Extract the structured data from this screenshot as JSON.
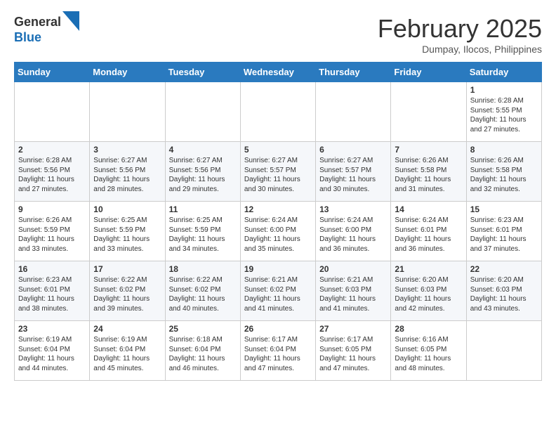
{
  "logo": {
    "general": "General",
    "blue": "Blue"
  },
  "header": {
    "month": "February 2025",
    "location": "Dumpay, Ilocos, Philippines"
  },
  "weekdays": [
    "Sunday",
    "Monday",
    "Tuesday",
    "Wednesday",
    "Thursday",
    "Friday",
    "Saturday"
  ],
  "weeks": [
    [
      null,
      null,
      null,
      null,
      null,
      null,
      {
        "day": "1",
        "sunrise": "6:28 AM",
        "sunset": "5:55 PM",
        "daylight": "11 hours and 27 minutes."
      }
    ],
    [
      {
        "day": "2",
        "sunrise": "6:28 AM",
        "sunset": "5:56 PM",
        "daylight": "11 hours and 27 minutes."
      },
      {
        "day": "3",
        "sunrise": "6:27 AM",
        "sunset": "5:56 PM",
        "daylight": "11 hours and 28 minutes."
      },
      {
        "day": "4",
        "sunrise": "6:27 AM",
        "sunset": "5:56 PM",
        "daylight": "11 hours and 29 minutes."
      },
      {
        "day": "5",
        "sunrise": "6:27 AM",
        "sunset": "5:57 PM",
        "daylight": "11 hours and 30 minutes."
      },
      {
        "day": "6",
        "sunrise": "6:27 AM",
        "sunset": "5:57 PM",
        "daylight": "11 hours and 30 minutes."
      },
      {
        "day": "7",
        "sunrise": "6:26 AM",
        "sunset": "5:58 PM",
        "daylight": "11 hours and 31 minutes."
      },
      {
        "day": "8",
        "sunrise": "6:26 AM",
        "sunset": "5:58 PM",
        "daylight": "11 hours and 32 minutes."
      }
    ],
    [
      {
        "day": "9",
        "sunrise": "6:26 AM",
        "sunset": "5:59 PM",
        "daylight": "11 hours and 33 minutes."
      },
      {
        "day": "10",
        "sunrise": "6:25 AM",
        "sunset": "5:59 PM",
        "daylight": "11 hours and 33 minutes."
      },
      {
        "day": "11",
        "sunrise": "6:25 AM",
        "sunset": "5:59 PM",
        "daylight": "11 hours and 34 minutes."
      },
      {
        "day": "12",
        "sunrise": "6:24 AM",
        "sunset": "6:00 PM",
        "daylight": "11 hours and 35 minutes."
      },
      {
        "day": "13",
        "sunrise": "6:24 AM",
        "sunset": "6:00 PM",
        "daylight": "11 hours and 36 minutes."
      },
      {
        "day": "14",
        "sunrise": "6:24 AM",
        "sunset": "6:01 PM",
        "daylight": "11 hours and 36 minutes."
      },
      {
        "day": "15",
        "sunrise": "6:23 AM",
        "sunset": "6:01 PM",
        "daylight": "11 hours and 37 minutes."
      }
    ],
    [
      {
        "day": "16",
        "sunrise": "6:23 AM",
        "sunset": "6:01 PM",
        "daylight": "11 hours and 38 minutes."
      },
      {
        "day": "17",
        "sunrise": "6:22 AM",
        "sunset": "6:02 PM",
        "daylight": "11 hours and 39 minutes."
      },
      {
        "day": "18",
        "sunrise": "6:22 AM",
        "sunset": "6:02 PM",
        "daylight": "11 hours and 40 minutes."
      },
      {
        "day": "19",
        "sunrise": "6:21 AM",
        "sunset": "6:02 PM",
        "daylight": "11 hours and 41 minutes."
      },
      {
        "day": "20",
        "sunrise": "6:21 AM",
        "sunset": "6:03 PM",
        "daylight": "11 hours and 41 minutes."
      },
      {
        "day": "21",
        "sunrise": "6:20 AM",
        "sunset": "6:03 PM",
        "daylight": "11 hours and 42 minutes."
      },
      {
        "day": "22",
        "sunrise": "6:20 AM",
        "sunset": "6:03 PM",
        "daylight": "11 hours and 43 minutes."
      }
    ],
    [
      {
        "day": "23",
        "sunrise": "6:19 AM",
        "sunset": "6:04 PM",
        "daylight": "11 hours and 44 minutes."
      },
      {
        "day": "24",
        "sunrise": "6:19 AM",
        "sunset": "6:04 PM",
        "daylight": "11 hours and 45 minutes."
      },
      {
        "day": "25",
        "sunrise": "6:18 AM",
        "sunset": "6:04 PM",
        "daylight": "11 hours and 46 minutes."
      },
      {
        "day": "26",
        "sunrise": "6:17 AM",
        "sunset": "6:04 PM",
        "daylight": "11 hours and 47 minutes."
      },
      {
        "day": "27",
        "sunrise": "6:17 AM",
        "sunset": "6:05 PM",
        "daylight": "11 hours and 47 minutes."
      },
      {
        "day": "28",
        "sunrise": "6:16 AM",
        "sunset": "6:05 PM",
        "daylight": "11 hours and 48 minutes."
      },
      null
    ]
  ]
}
